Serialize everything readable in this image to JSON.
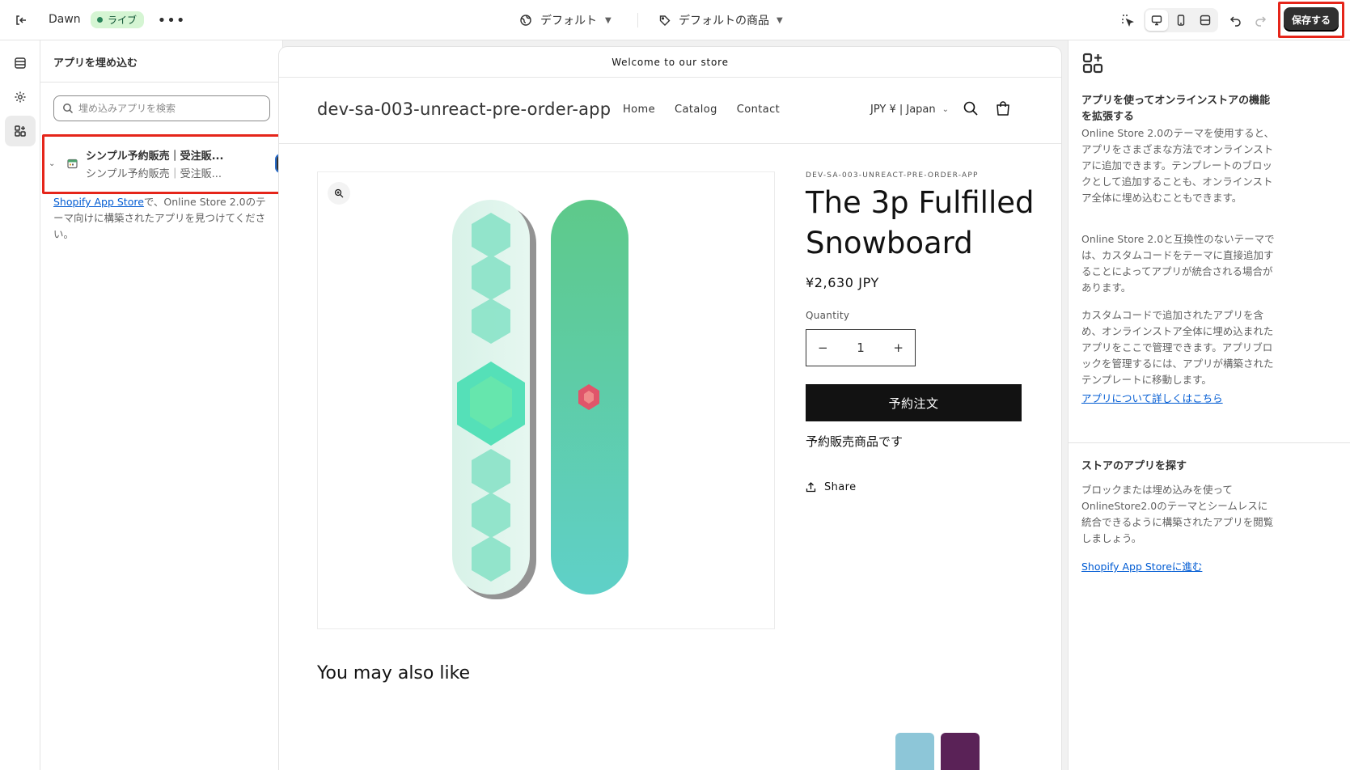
{
  "topbar": {
    "theme_name": "Dawn",
    "live_label": "ライブ",
    "template_label": "デフォルト",
    "product_label": "デフォルトの商品",
    "save_label": "保存する"
  },
  "rail": {
    "items": [
      {
        "icon": "sections-icon"
      },
      {
        "icon": "gear-icon"
      },
      {
        "icon": "apps-icon",
        "active": true
      }
    ]
  },
  "left_panel": {
    "title": "アプリを埋め込む",
    "search_placeholder": "埋め込みアプリを検索",
    "app": {
      "title": "シンプル予約販売｜受注販...",
      "subtitle": "シンプル予約販売｜受注販...",
      "enabled": true
    },
    "help_link": "Shopify App Store",
    "help_text": "で、Online Store 2.0のテーマ向けに構築されたアプリを見つけてください。"
  },
  "preview": {
    "announcement": "Welcome to our store",
    "store_name": "dev-sa-003-unreact-pre-order-app",
    "nav": [
      "Home",
      "Catalog",
      "Contact"
    ],
    "currency": "JPY ¥ | Japan",
    "vendor": "DEV-SA-003-UNREACT-PRE-ORDER-APP",
    "product_title": "The 3p Fulfilled Snowboard",
    "price": "¥2,630 JPY",
    "quantity_label": "Quantity",
    "quantity_value": "1",
    "qty_minus": "−",
    "qty_plus": "+",
    "preorder_button": "予約注文",
    "preorder_note": "予約販売商品です",
    "share_label": "Share",
    "also_like": "You may also like"
  },
  "right_panel": {
    "heading1": "アプリを使ってオンラインストアの機能を拡張する",
    "para1": "Online Store 2.0のテーマを使用すると、アプリをさまざまな方法でオンラインストアに追加できます。テンプレートのブロックとして追加することも、オンラインストア全体に埋め込むこともできます。",
    "para2": "Online Store 2.0と互換性のないテーマでは、カスタムコードをテーマに直接追加することによってアプリが統合される場合があります。",
    "para3": "カスタムコードで追加されたアプリを含め、オンラインストア全体に埋め込まれたアプリをここで管理できます。アプリブロックを管理するには、アプリが構築されたテンプレートに移動します。",
    "learn_more_link": "アプリについて詳しくはこちら",
    "heading2": "ストアのアプリを探す",
    "para4": "ブロックまたは埋め込みを使ってOnlineStore2.0のテーマとシームレスに統合できるように構築されたアプリを閲覧しましょう。",
    "store_link_a": "Shopify App Store",
    "store_link_b": "に進む"
  },
  "colors": {
    "accent_outline": "#e5251a",
    "live_badge_bg": "#d5f5d3",
    "link": "#005bd3",
    "primary_button": "#121212"
  }
}
